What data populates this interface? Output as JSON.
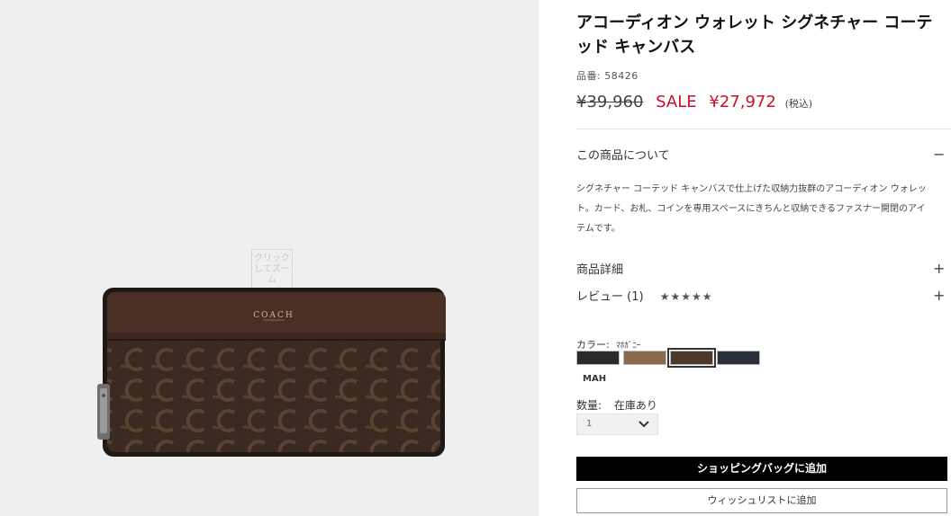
{
  "product": {
    "title": "アコーディオン ウォレット シグネチャー コーテッド キャンバス",
    "sku": "品番: 58426",
    "price_original": "¥39,960",
    "sale_label": "SALE",
    "price_sale": "¥27,972",
    "tax_label": "(税込)",
    "image_brand": "COACH"
  },
  "gallery": {
    "zoom_hint": "クリックしてズーム"
  },
  "about": {
    "label": "この商品について",
    "toggle": "−",
    "description": "シグネチャー コーテッド キャンバスで仕上げた収納力抜群のアコーディオン ウォレット。カード、お札、コインを専用スペースにきちんと収納できるファスナー開閉のアイテムです。"
  },
  "details": {
    "label": "商品詳細",
    "toggle": "+"
  },
  "reviews": {
    "label": "レビュー (1)",
    "stars": "★★★★★",
    "toggle": "+"
  },
  "color": {
    "label": "カラー:",
    "selected_name": "ﾏﾎｶﾞﾆｰ",
    "selected_code": "MAH",
    "swatches": [
      {
        "name": "black-signature",
        "color": "#2a2a2a"
      },
      {
        "name": "khaki-signature",
        "color": "#8a6a4c"
      },
      {
        "name": "mahogany-signature",
        "color": "#4b3a2c"
      },
      {
        "name": "charcoal-navy-signature",
        "color": "#2a2f3a"
      }
    ]
  },
  "quantity": {
    "label": "数量:",
    "stock": "在庫あり",
    "value": "1"
  },
  "actions": {
    "add_to_bag": "ショッピングバッグに追加",
    "add_to_wishlist": "ウィッシュリストに追加"
  },
  "colors": {
    "sale": "#c8102e",
    "gallery_bg": "#efefef",
    "wallet_body": "#3b2a22"
  }
}
